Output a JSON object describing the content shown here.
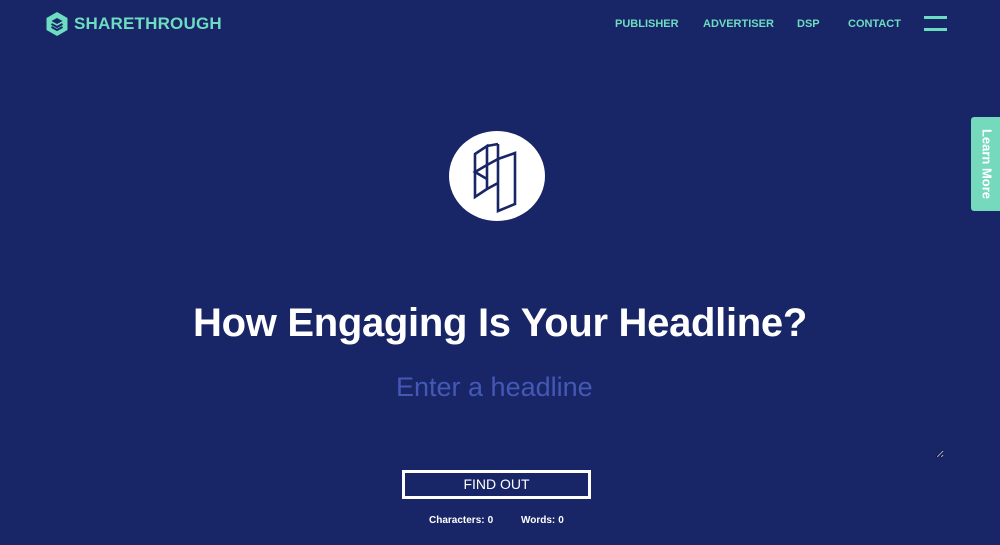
{
  "brand": {
    "name": "SHARETHROUGH",
    "icon": "hexagon-stack-icon",
    "color": "#6ddcc0"
  },
  "nav": {
    "items": [
      {
        "label": "PUBLISHER"
      },
      {
        "label": "ADVERTISER"
      },
      {
        "label": "DSP"
      },
      {
        "label": "CONTACT"
      }
    ],
    "menu_icon": "hamburger-menu-icon"
  },
  "side_tab": {
    "label": "Learn More"
  },
  "hero": {
    "logo_icon": "sharethrough-mark-icon",
    "title": "How Engaging Is Your Headline?",
    "input": {
      "value": "",
      "placeholder": "Enter a headline"
    },
    "submit_label": "FIND OUT",
    "stats": {
      "characters_label": "Characters:",
      "characters_value": "0",
      "words_label": "Words:",
      "words_value": "0"
    }
  },
  "colors": {
    "background": "#182566",
    "accent": "#6ddcc0",
    "placeholder": "#4558b6",
    "text": "#ffffff"
  }
}
